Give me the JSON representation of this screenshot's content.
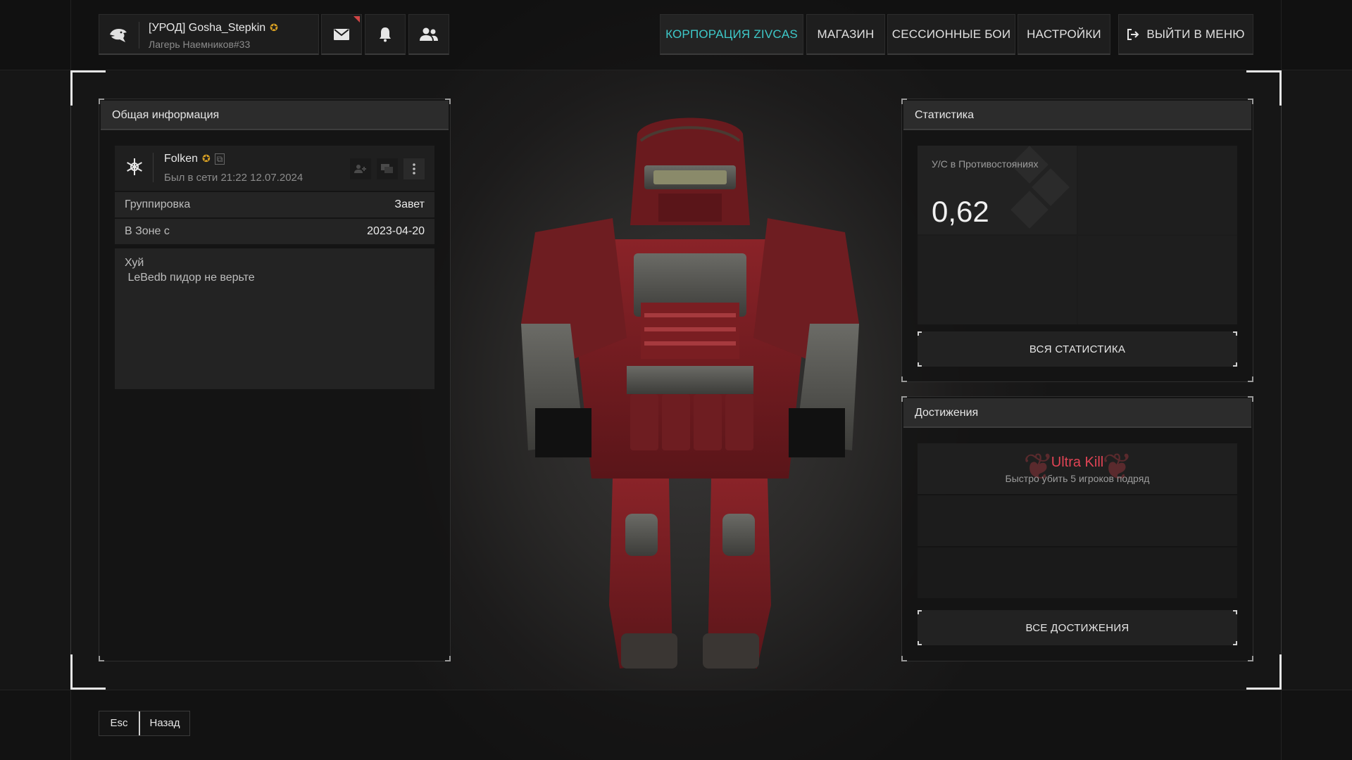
{
  "player": {
    "name": "[УРОД] Gosha_Stepkin",
    "badge": "✪",
    "subtitle": "Лагерь Наемников#33"
  },
  "icons": {
    "avatar": "eagle-icon",
    "mail": "mail-icon",
    "bell": "bell-icon",
    "friends": "friends-icon",
    "exit": "exit-icon"
  },
  "nav": {
    "items": [
      {
        "label": "КОРПОРАЦИЯ ZIVCAS",
        "active": true
      },
      {
        "label": "МАГАЗИН",
        "active": false
      },
      {
        "label": "СЕССИОННЫЕ БОИ",
        "active": false
      },
      {
        "label": "НАСТРОЙКИ",
        "active": false
      }
    ],
    "exit_label": "ВЫЙТИ В МЕНЮ"
  },
  "general": {
    "title": "Общая информация",
    "user": {
      "name": "Folken",
      "badge": "✪",
      "copy": "⧉",
      "last_seen": "Был в сети 21:22 12.07.2024"
    },
    "rows": [
      {
        "key": "Группировка",
        "value": "Завет"
      },
      {
        "key": "В Зоне с",
        "value": "2023-04-20"
      }
    ],
    "about": [
      "Хуй",
      " LeBedb пидор не верьте"
    ]
  },
  "stats": {
    "title": "Статистика",
    "label": "У/С в Противостояниях",
    "value": "0,62",
    "button": "ВСЯ СТАТИСТИКА"
  },
  "achievements": {
    "title": "Достижения",
    "items": [
      {
        "title": "Ultra Kill",
        "description": "Быстро убить 5 игроков подряд"
      }
    ],
    "button": "ВСЕ ДОСТИЖЕНИЯ"
  },
  "footer": {
    "key": "Esc",
    "label": "Назад"
  },
  "colors": {
    "accent": "#3ec9c9",
    "achievement": "#e04455",
    "badge": "#d8a023",
    "armor_red": "#7a1e22"
  }
}
